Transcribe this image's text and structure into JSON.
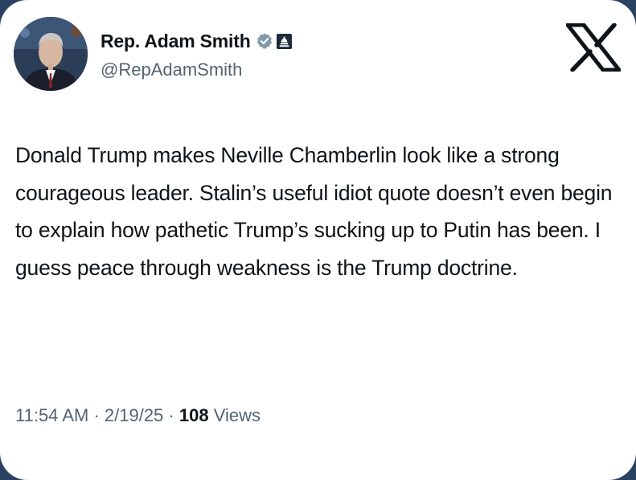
{
  "author": {
    "display_name": "Rep. Adam Smith",
    "handle": "@RepAdamSmith",
    "verified_badge_icon": "verified-badge-icon",
    "affiliation_badge_icon": "government-building-icon",
    "verified_color": "#829aab"
  },
  "platform": {
    "logo_icon": "x-logo-icon"
  },
  "tweet": {
    "text": "Donald Trump makes Neville Chamberlin look like a strong courageous leader. Stalin’s useful idiot quote doesn’t even begin to explain how pathetic Trump’s sucking up to Putin has been. I guess peace through weakness is the Trump doctrine."
  },
  "meta": {
    "time": "11:54 AM",
    "separator": " · ",
    "date": "2/19/25",
    "views_count": "108",
    "views_label": " Views"
  },
  "colors": {
    "text_primary": "#0f1419",
    "text_secondary": "#536471",
    "card_background": "#ffffff"
  }
}
